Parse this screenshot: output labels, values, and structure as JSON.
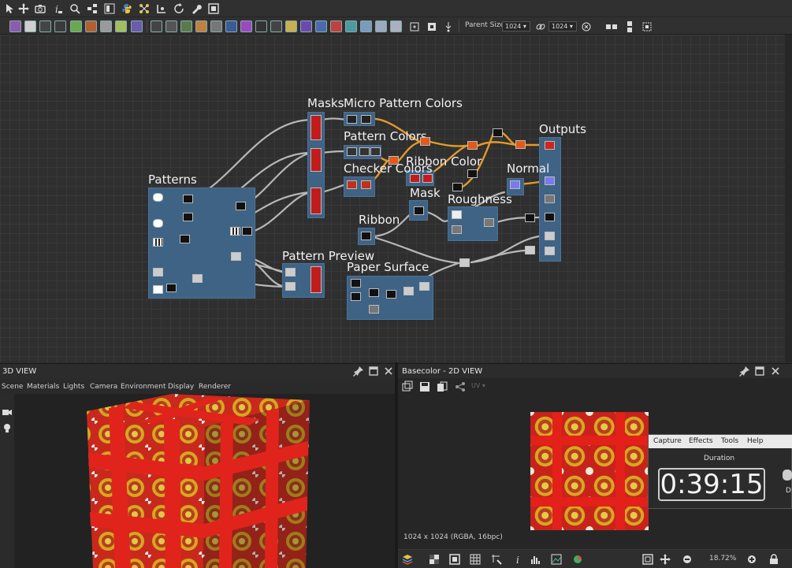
{
  "toolbar": {
    "parent_size_label": "Parent Size:",
    "parent_size_value": "1024",
    "parent_size_value2": "1024"
  },
  "graph": {
    "frames": {
      "masks": "Masks",
      "micro_pattern_colors": "Micro Pattern Colors",
      "pattern_colors": "Pattern Colors",
      "checker_colors": "Checker Colors",
      "ribbon_color": "Ribbon Color",
      "mask": "Mask",
      "outputs": "Outputs",
      "normal": "Normal",
      "roughness": "Roughness",
      "patterns": "Patterns",
      "ribbon": "Ribbon",
      "pattern_preview": "Pattern Preview",
      "paper_surface": "Paper Surface"
    }
  },
  "view3d": {
    "title": "3D VIEW",
    "menu": [
      "Scene",
      "Materials",
      "Lights",
      "Camera",
      "Environment",
      "Display",
      "Renderer"
    ]
  },
  "view2d": {
    "title": "Basecolor - 2D VIEW",
    "uv_label": "UV",
    "image_info": "1024 x 1024 (RGBA, 16bpc)",
    "zoom": "18.72%"
  },
  "timer_overlay": {
    "menu": [
      "Capture",
      "Effects",
      "Tools",
      "Help"
    ],
    "duration_label": "Duration",
    "duration_value": "0:39:15",
    "side_text": "D"
  },
  "colors": {
    "frame": "#3f6384",
    "wire_gray": "#b8b8b8",
    "wire_orange": "#e39a2b",
    "texture_red": "#d0241d",
    "texture_gold": "#d7a320"
  }
}
